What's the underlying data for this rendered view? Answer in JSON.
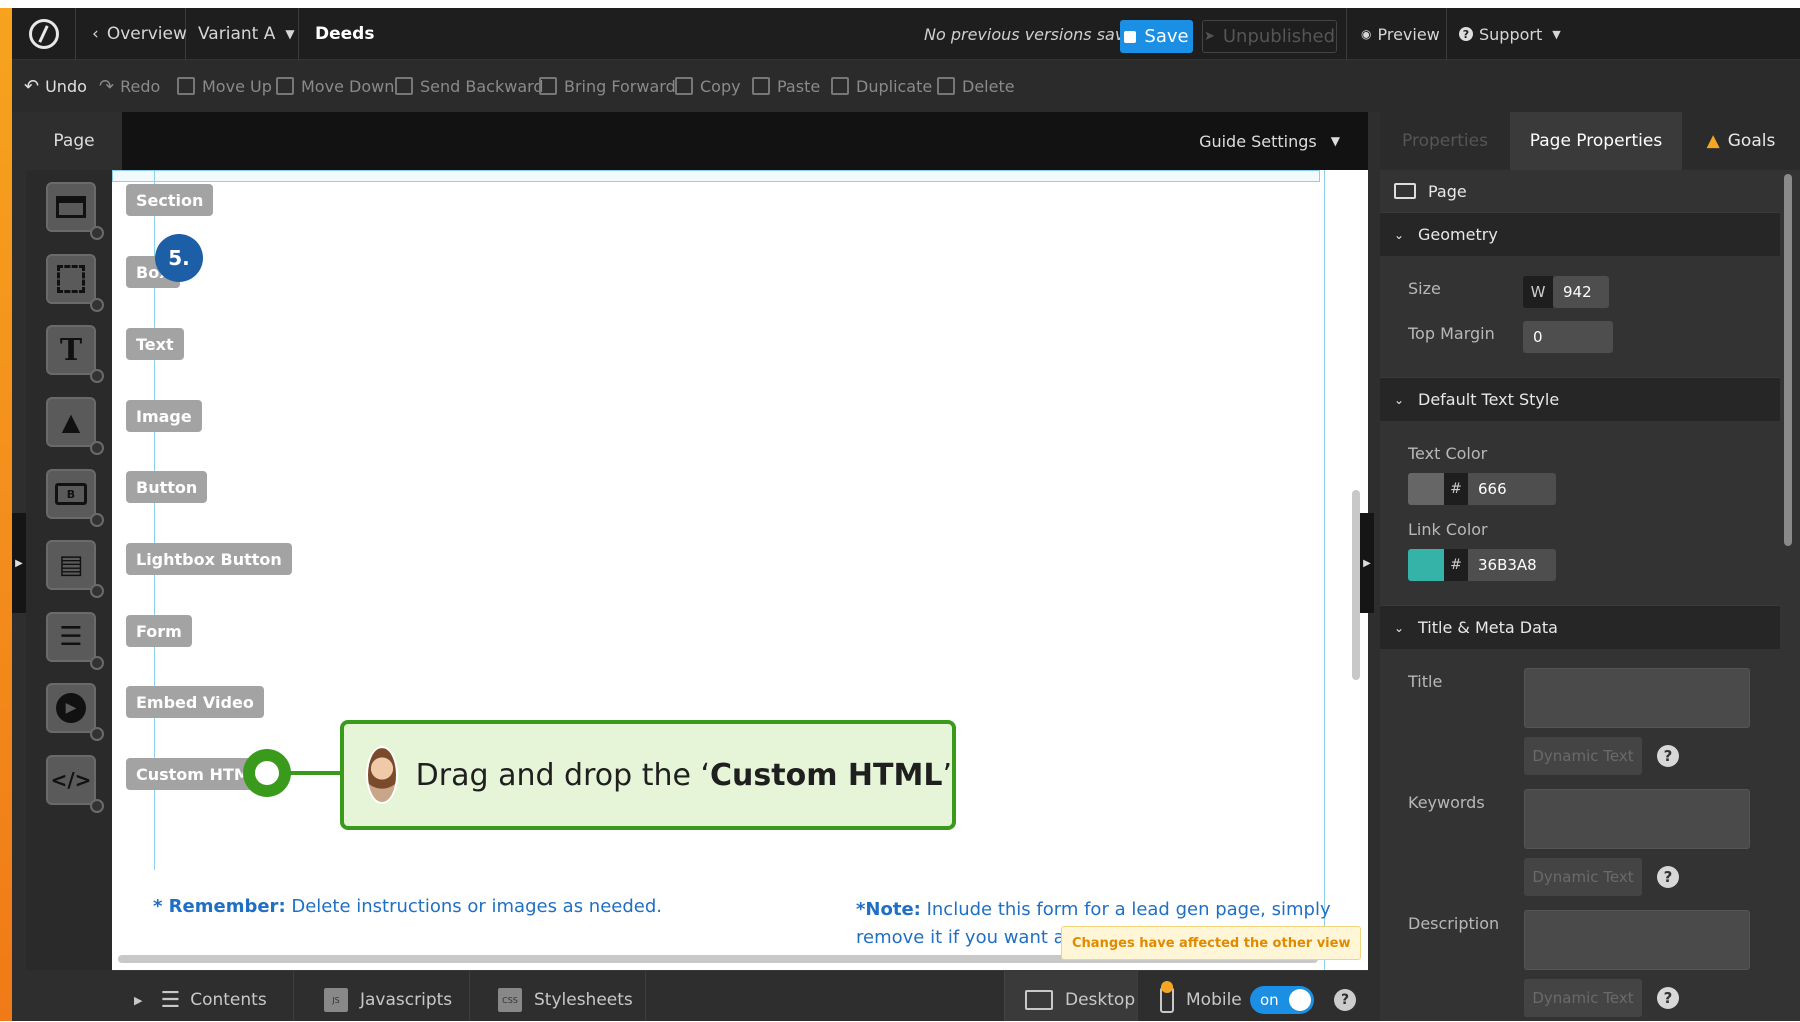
{
  "topbar": {
    "overview": "Overview",
    "variant": "Variant A",
    "page_name": "Deeds",
    "versions_status": "No previous versions saved",
    "save": "Save",
    "unpublished": "Unpublished",
    "preview": "Preview",
    "support": "Support"
  },
  "toolbar": {
    "undo": "Undo",
    "redo": "Redo",
    "move_up": "Move Up",
    "move_down": "Move Down",
    "send_backward": "Send Backward",
    "bring_forward": "Bring Forward",
    "copy": "Copy",
    "paste": "Paste",
    "duplicate": "Duplicate",
    "delete": "Delete"
  },
  "canvas_head": {
    "page_tab": "Page",
    "guide_settings": "Guide Settings"
  },
  "elements": {
    "section": "Section",
    "box": "Box",
    "text": "Text",
    "image": "Image",
    "button": "Button",
    "lightbox_button": "Lightbox Button",
    "form": "Form",
    "embed_video": "Embed Video",
    "custom_html": "Custom HTML"
  },
  "step_badge": "5.",
  "callout": {
    "prefix": "Drag and drop the ‘",
    "bold": "Custom HTML",
    "suffix": "’"
  },
  "notes": {
    "remember_label": "* Remember:",
    "remember_text": "Delete instructions or images as needed.",
    "note_label": "*Note:",
    "note_text_line1": "Include this form for a lead gen page, simply",
    "note_text_line2": "remove it if you want a c"
  },
  "tooltip": "Changes have affected the other view",
  "bottom": {
    "contents": "Contents",
    "javascripts": "Javascripts",
    "stylesheets": "Stylesheets",
    "js_badge": "JS",
    "css_badge": "CSS",
    "desktop": "Desktop",
    "mobile": "Mobile",
    "toggle": "on"
  },
  "panel": {
    "tabs": {
      "properties": "Properties",
      "page_properties": "Page Properties",
      "goals": "Goals"
    },
    "page_label": "Page",
    "geometry": "Geometry",
    "size_label": "Size",
    "size_prefix": "W",
    "size_value": "942",
    "top_margin_label": "Top Margin",
    "top_margin_value": "0",
    "default_text_style": "Default Text Style",
    "text_color_label": "Text Color",
    "text_color_value": "666",
    "text_color_swatch": "#666666",
    "link_color_label": "Link Color",
    "link_color_value": "36B3A8",
    "link_color_swatch": "#36B3A8",
    "hash": "#",
    "title_meta": "Title & Meta Data",
    "title_label": "Title",
    "keywords_label": "Keywords",
    "description_label": "Description",
    "dynamic_text": "Dynamic Text",
    "help": "?"
  },
  "colors": {
    "accent_blue": "#1a8fe3",
    "callout_border": "#3a9a1c",
    "callout_bg": "#e6f4d8",
    "note_blue": "#1f6fc4",
    "badge_blue": "#1c5fa6",
    "orange": "#f5a623"
  }
}
